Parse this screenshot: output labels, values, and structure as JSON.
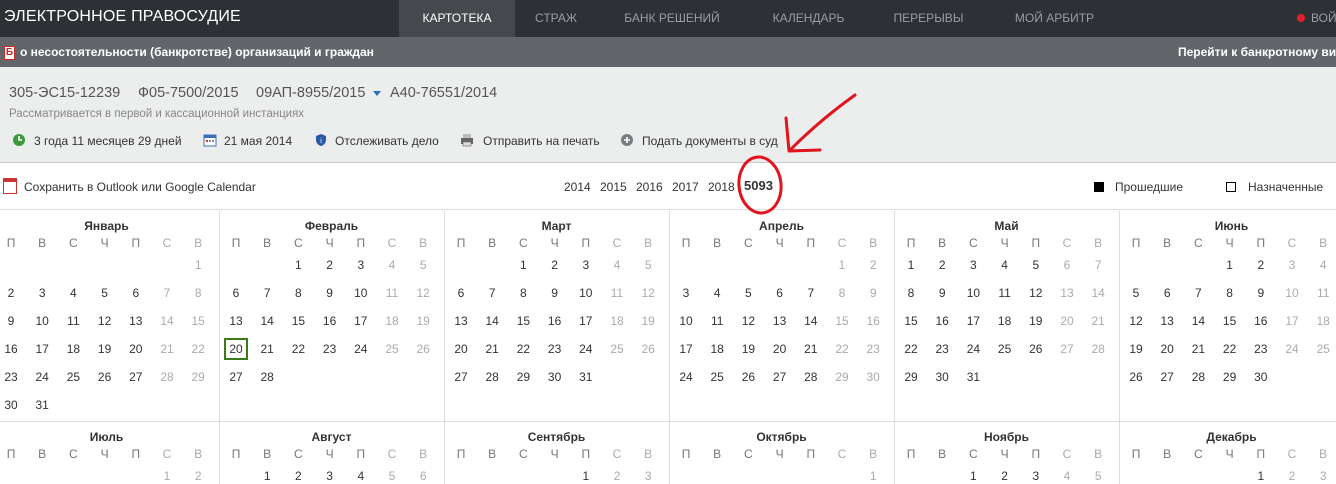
{
  "header": {
    "brand": "ЭЛЕКТРОННОЕ ПРАВОСУДИЕ",
    "nav": [
      "КАРТОТЕКА",
      "СТРАЖ",
      "БАНК РЕШЕНИЙ",
      "КАЛЕНДАРЬ",
      "ПЕРЕРЫВЫ",
      "МОЙ АРБИТР"
    ],
    "nav_last": "ВОЙ",
    "active_nav": "КАРТОТЕКА"
  },
  "bankruptcy": {
    "icon_letter": "Б",
    "title": "о несостоятельности (банкротстве) организаций и граждан",
    "right_link": "Перейти к банкротному ви"
  },
  "case": {
    "numbers": [
      "305-ЭС15-12239",
      "Ф05-7500/2015",
      "09АП-8955/2015",
      "А40-76551/2014"
    ],
    "subtitle": "Рассматривается в первой и кассационной инстанциях",
    "actions": [
      {
        "label": "3 года 11 месяцев 29 дней",
        "icon": "clock-back-icon"
      },
      {
        "label": "21 мая 2014",
        "icon": "calendar-icon"
      },
      {
        "label": "Отслеживать дело",
        "icon": "shield-icon"
      },
      {
        "label": "Отправить на печать",
        "icon": "printer-icon"
      },
      {
        "label": "Подать документы в суд",
        "icon": "plus-circle-icon"
      }
    ]
  },
  "calendar_bar": {
    "outlook_label": "Сохранить в Outlook или Google Calendar",
    "years": [
      "2014",
      "2015",
      "2016",
      "2017",
      "2018",
      "5093"
    ],
    "active_year": "5093",
    "legend_past": "Прошедшие",
    "legend_scheduled": "Назначенные"
  },
  "weekdays": [
    "П",
    "В",
    "С",
    "Ч",
    "П",
    "С",
    "В"
  ],
  "months": [
    {
      "name": "Январь",
      "offset": 6,
      "days": 31
    },
    {
      "name": "Февраль",
      "offset": 2,
      "days": 28,
      "highlight": 20
    },
    {
      "name": "Март",
      "offset": 2,
      "days": 31
    },
    {
      "name": "Апрель",
      "offset": 5,
      "days": 30
    },
    {
      "name": "Май",
      "offset": 0,
      "days": 31
    },
    {
      "name": "Июнь",
      "offset": 3,
      "days": 30
    },
    {
      "name": "Июль",
      "offset": 5,
      "days": 31
    },
    {
      "name": "Август",
      "offset": 1,
      "days": 31
    },
    {
      "name": "Сентябрь",
      "offset": 4,
      "days": 30
    },
    {
      "name": "Октябрь",
      "offset": 6,
      "days": 31
    },
    {
      "name": "Ноябрь",
      "offset": 2,
      "days": 30
    },
    {
      "name": "Декабрь",
      "offset": 4,
      "days": 31
    }
  ],
  "colors": {
    "topbar": "#2d3035",
    "bankruptcy_bar": "#62666b",
    "case_bg": "#eceded",
    "accent_link": "#2a6fc0",
    "today_border": "#3a7a1a",
    "annotation_red": "#e0141c"
  }
}
